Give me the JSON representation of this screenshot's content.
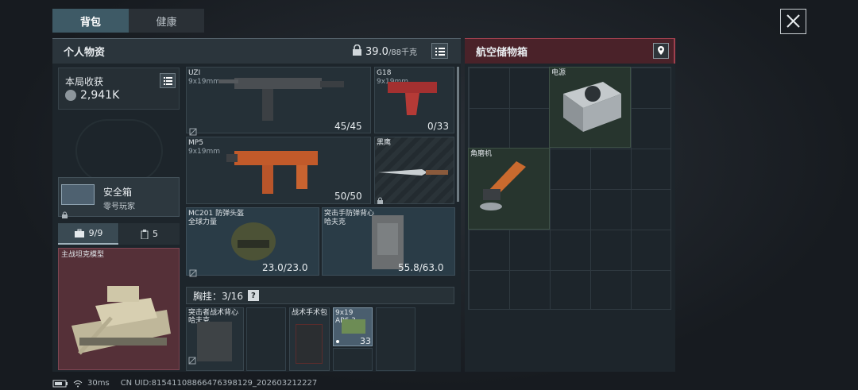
{
  "tabs": [
    "背包",
    "健康"
  ],
  "left_panel": {
    "title": "个人物资",
    "weight": "39.0",
    "weight_max": "/88千克"
  },
  "earnings": {
    "label": "本局收获",
    "value": "2,941K"
  },
  "safe_box": {
    "title": "安全箱",
    "subtitle": "零号玩家"
  },
  "subtabs": [
    {
      "label": "9/9"
    },
    {
      "label": "5"
    }
  ],
  "tank": {
    "label": "主战坦克模型"
  },
  "weapons": [
    {
      "name": "UZI",
      "caliber": "9x19mm",
      "ammo": "45/45"
    },
    {
      "name": "G18",
      "caliber": "9x19mm",
      "ammo": "0/33"
    },
    {
      "name": "MP5",
      "caliber": "9x19mm",
      "ammo": "50/50"
    },
    {
      "name": "黑鹰",
      "caliber": "",
      "ammo": ""
    }
  ],
  "armor": [
    {
      "name": "MC201 防弹头盔",
      "sub": "全球力量",
      "durability": "23.0/23.0"
    },
    {
      "name": "突击手防弹背心",
      "sub": "哈夫克",
      "durability": "55.8/63.0"
    }
  ],
  "rig": {
    "label": "胸挂：3/16",
    "help": "?"
  },
  "rig_items": [
    {
      "name": "突击者战术背心",
      "sub": "哈夫克"
    },
    {
      "name": "战术手术包",
      "sub": ""
    },
    {
      "name": "9x19",
      "sub": "AP6.3",
      "count": "33"
    }
  ],
  "right_panel": {
    "title": "航空储物箱"
  },
  "right_items": [
    {
      "name": "电源"
    },
    {
      "name": "角磨机"
    }
  ],
  "status": {
    "ping": "30ms",
    "uid": "CN UID:815411088664763981​29_202603212227"
  },
  "colors": {
    "accent_red": "#7a2a33",
    "panel": "#1e262c",
    "blue_slot": "#2a3c47"
  }
}
